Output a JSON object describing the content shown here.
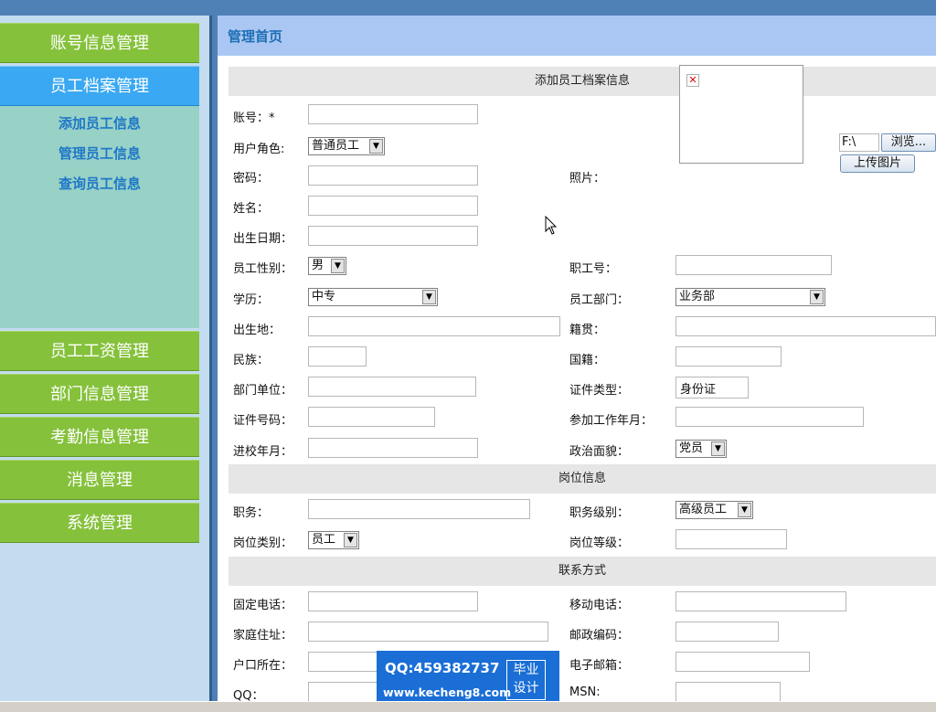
{
  "sidebar": {
    "menu_top": [
      "账号信息管理",
      "员工档案管理"
    ],
    "submenu": [
      "添加员工信息",
      "管理员工信息",
      "查询员工信息"
    ],
    "menu_bottom": [
      "员工工资管理",
      "部门信息管理",
      "考勤信息管理",
      "消息管理",
      "系统管理"
    ]
  },
  "header": {
    "title": "管理首页"
  },
  "sections": {
    "add": "添加员工档案信息",
    "post": "岗位信息",
    "contact": "联系方式"
  },
  "labels": {
    "account": "账号：*",
    "role": "用户角色:",
    "password": "密码：",
    "name": "姓名：",
    "birthdate": "出生日期：",
    "gender": "员工性别：",
    "education": "学历：",
    "birthplace": "出生地：",
    "ethnicity": "民族：",
    "dept_unit": "部门单位：",
    "id_number": "证件号码：",
    "school_year": "进校年月：",
    "photo": "照片：",
    "staff_no": "职工号：",
    "staff_dept": "员工部门：",
    "native_place": "籍贯：",
    "nationality": "国籍：",
    "id_type": "证件类型：",
    "work_start": "参加工作年月：",
    "political": "政治面貌：",
    "position": "职务：",
    "position_level": "职务级别：",
    "post_type": "岗位类别：",
    "post_grade": "岗位等级：",
    "phone": "固定电话：",
    "mobile": "移动电话：",
    "address": "家庭住址：",
    "postcode": "邮政编码：",
    "hukou": "户口所在：",
    "email": "电子邮箱：",
    "qq": "QQ：",
    "msn": "MSN:"
  },
  "selects": {
    "role": "普通员工",
    "gender": "男",
    "education": "中专",
    "staff_dept": "业务部",
    "political": "党员",
    "position_level": "高级员工",
    "post_type": "员工"
  },
  "values": {
    "id_type": "身份证",
    "file_path": "F:\\"
  },
  "buttons": {
    "browse": "浏览...",
    "upload": "上传图片"
  },
  "broken_image_glyph": "✕",
  "watermark": {
    "qq": "QQ:459382737",
    "url": "www.kecheng8.com",
    "tag_line1": "毕业",
    "tag_line2": "设计"
  },
  "colors": {
    "menu_green": "#85c13b",
    "menu_active": "#3aa8f2",
    "submenu_bg": "#98d1c6",
    "header_bg": "#a9c7f2",
    "section_bg": "#e6e6e6"
  }
}
